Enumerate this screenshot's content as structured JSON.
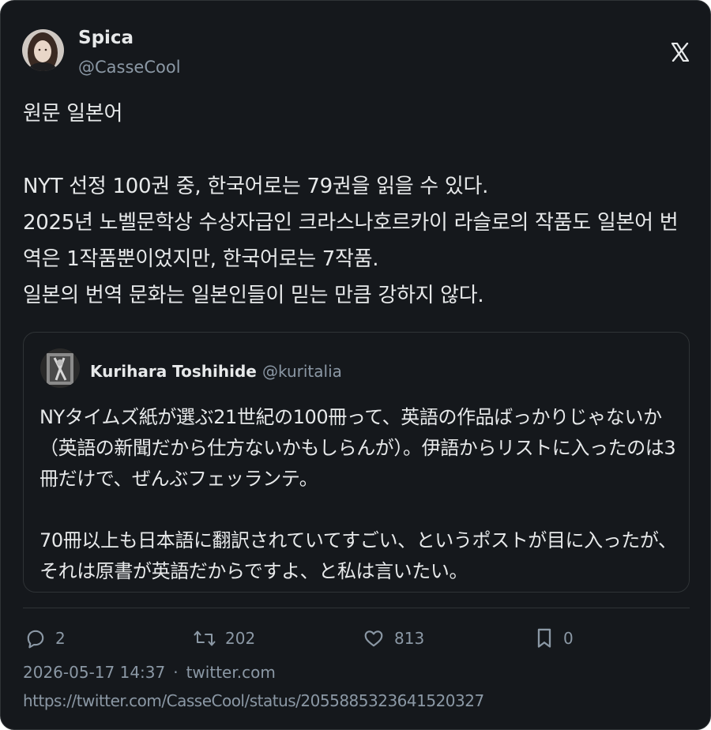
{
  "tweet": {
    "author_name": "Spica",
    "author_handle": "@CasseCool",
    "text": "원문 일본어\n\nNYT 선정 100권 중, 한국어로는 79권을 읽을 수 있다.\n2025년 노벨문학상 수상자급인 크라스나호르카이 라슬로의 작품도 일본어 번역은 1작품뿐이었지만, 한국어로는 7작품.\n일본의 번역 문화는 일본인들이 믿는 만큼 강하지 않다."
  },
  "quoted": {
    "author_name": "Kurihara Toshihide",
    "author_handle": "@kuritalia",
    "text": "NYタイムズ紙が選ぶ21世紀の100冊って、英語の作品ばっかりじゃないか（英語の新聞だから仕方ないかもしらんが）。伊語からリストに入ったのは3冊だけで、ぜんぶフェッランテ。\n\n70冊以上も日本語に翻訳されていてすごい、というポストが目に入ったが、それは原書が英語だからですよ、と私は言いたい。"
  },
  "actions": {
    "replies": "2",
    "retweets": "202",
    "likes": "813",
    "bookmarks": "0"
  },
  "meta": {
    "timestamp": "2026-05-17 14:37",
    "separator": "·",
    "source": "twitter.com",
    "url": "https://twitter.com/CasseCool/status/2055885323641520327"
  },
  "icons": {
    "brand": "x-logo-icon",
    "reply": "reply-icon",
    "retweet": "retweet-icon",
    "like": "heart-icon",
    "bookmark": "bookmark-icon"
  },
  "colors": {
    "background": "#15181c",
    "text": "#e7e9ea",
    "secondary": "#8b98a5",
    "border": "#2f3336"
  }
}
